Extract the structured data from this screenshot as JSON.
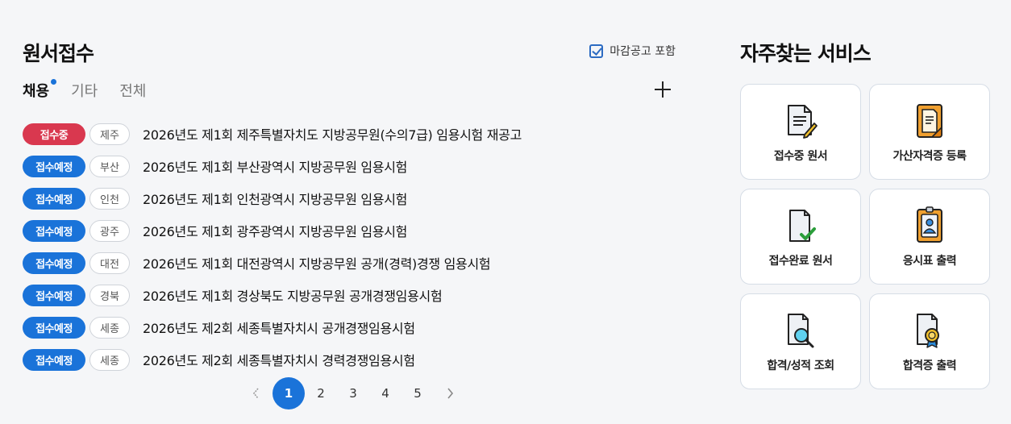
{
  "applications": {
    "title": "원서접수",
    "include_closed_label": "마감공고 포함",
    "tabs": [
      {
        "label": "채용",
        "active": true
      },
      {
        "label": "기타",
        "active": false
      },
      {
        "label": "전체",
        "active": false
      }
    ],
    "items": [
      {
        "status": "접수중",
        "status_type": "open",
        "region": "제주",
        "title": "2026년도 제1회 제주특별자치도 지방공무원(수의7급) 임용시험 재공고"
      },
      {
        "status": "접수예정",
        "status_type": "planned",
        "region": "부산",
        "title": "2026년도 제1회 부산광역시 지방공무원 임용시험"
      },
      {
        "status": "접수예정",
        "status_type": "planned",
        "region": "인천",
        "title": "2026년도 제1회 인천광역시 지방공무원 임용시험"
      },
      {
        "status": "접수예정",
        "status_type": "planned",
        "region": "광주",
        "title": "2026년도 제1회 광주광역시 지방공무원 임용시험"
      },
      {
        "status": "접수예정",
        "status_type": "planned",
        "region": "대전",
        "title": "2026년도 제1회 대전광역시 지방공무원 공개(경력)경쟁 임용시험"
      },
      {
        "status": "접수예정",
        "status_type": "planned",
        "region": "경북",
        "title": "2026년도 제1회 경상북도 지방공무원 공개경쟁임용시험"
      },
      {
        "status": "접수예정",
        "status_type": "planned",
        "region": "세종",
        "title": "2026년도 제2회 세종특별자치시 공개경쟁임용시험"
      },
      {
        "status": "접수예정",
        "status_type": "planned",
        "region": "세종",
        "title": "2026년도 제2회 세종특별자치시 경력경쟁임용시험"
      }
    ],
    "pagination": {
      "pages": [
        "1",
        "2",
        "3",
        "4",
        "5"
      ],
      "current": "1"
    }
  },
  "services": {
    "title": "자주찾는 서비스",
    "items": [
      {
        "label": "접수중 원서",
        "icon": "document-pencil-icon"
      },
      {
        "label": "가산자격증 등록",
        "icon": "certificate-icon"
      },
      {
        "label": "접수완료 원서",
        "icon": "document-check-icon"
      },
      {
        "label": "응시표 출력",
        "icon": "id-card-icon"
      },
      {
        "label": "합격/성적 조회",
        "icon": "document-search-icon"
      },
      {
        "label": "합격증 출력",
        "icon": "document-medal-icon"
      }
    ]
  },
  "colors": {
    "open": "#d9384f",
    "planned": "#1a73d9",
    "accent": "#1a73d9"
  }
}
